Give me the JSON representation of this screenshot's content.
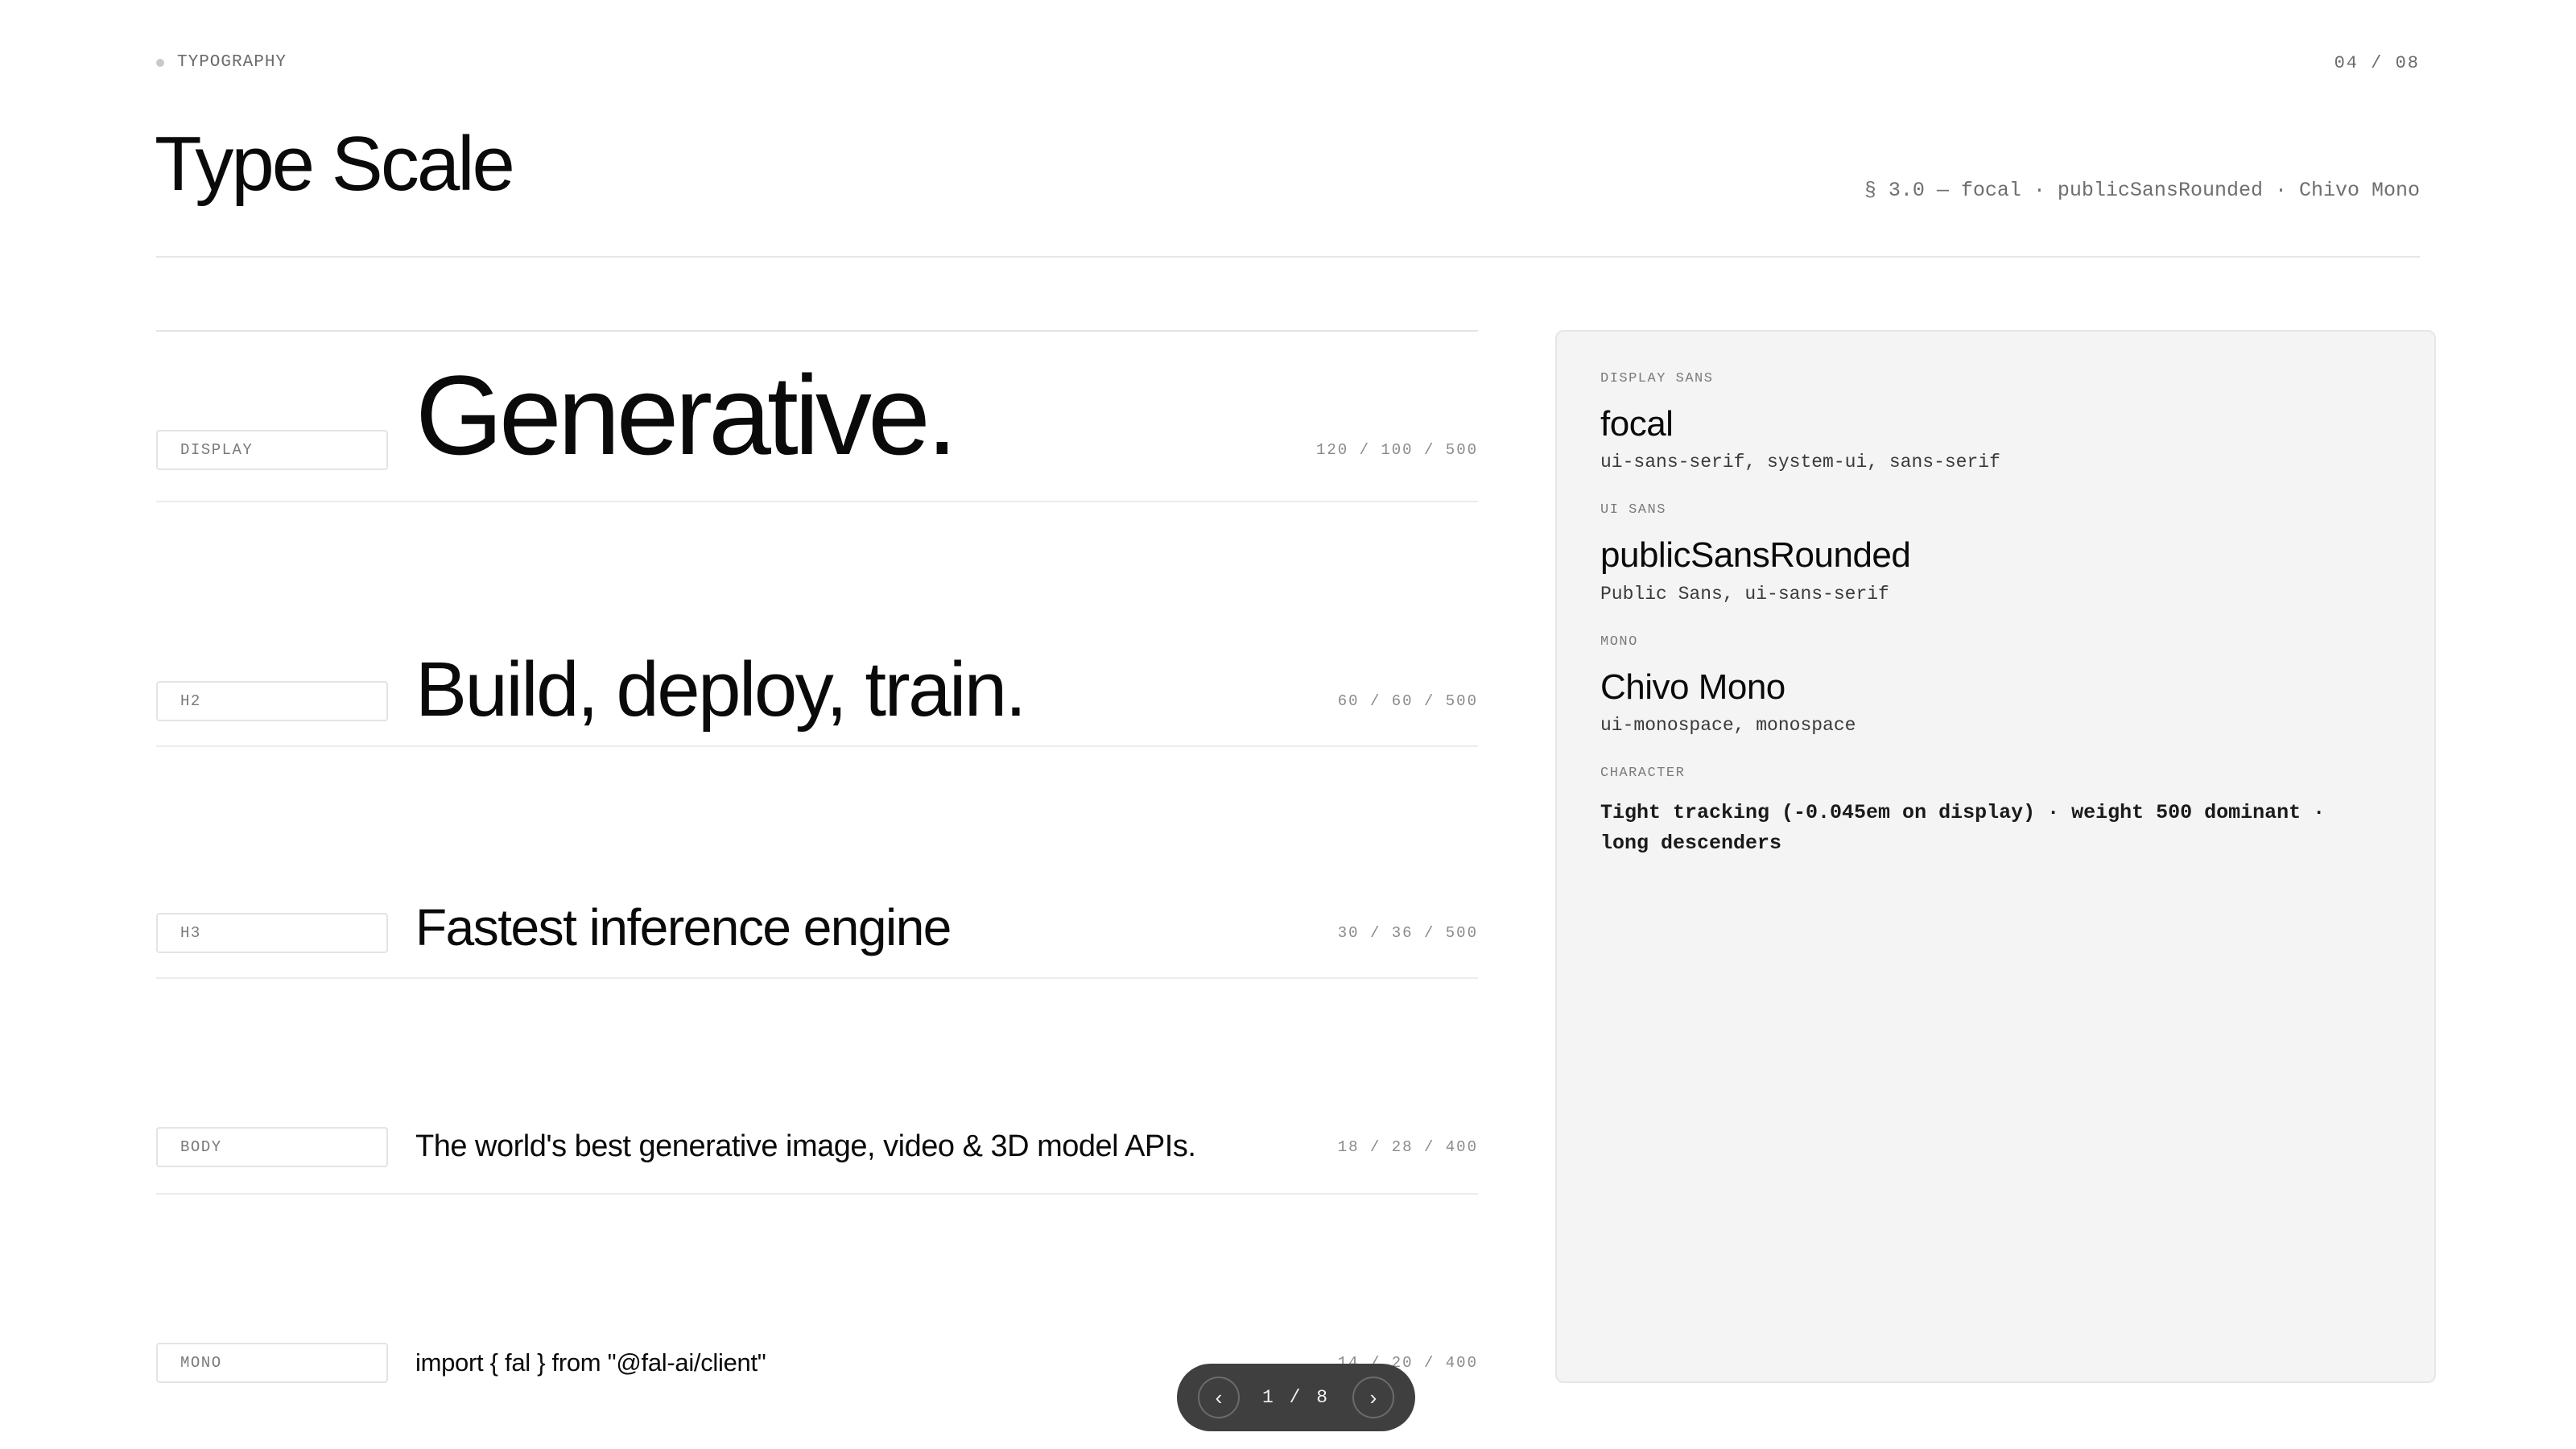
{
  "header": {
    "eyebrow": "TYPOGRAPHY",
    "page_counter": "04 / 08",
    "title": "Type Scale",
    "font_summary": "§ 3.0 — focal · publicSansRounded · Chivo Mono"
  },
  "scale": [
    {
      "tag": "DISPLAY",
      "sample": "Generative.",
      "metrics": "120 / 100 / 500"
    },
    {
      "tag": "H2",
      "sample": "Build, deploy, train.",
      "metrics": "60 / 60 / 500"
    },
    {
      "tag": "H3",
      "sample": "Fastest inference engine",
      "metrics": "30 / 36 / 500"
    },
    {
      "tag": "BODY",
      "sample": "The world's best generative image, video & 3D model APIs.",
      "metrics": "18 / 28 / 400"
    },
    {
      "tag": "MONO",
      "sample": "import { fal } from \"@fal-ai/client\"",
      "metrics": "14 / 20 / 400"
    }
  ],
  "panel": {
    "groups": [
      {
        "label": "DISPLAY SANS",
        "name": "focal",
        "stack": "ui-sans-serif, system-ui, sans-serif"
      },
      {
        "label": "UI SANS",
        "name": "publicSansRounded",
        "stack": "Public Sans, ui-sans-serif"
      },
      {
        "label": "MONO",
        "name": "Chivo Mono",
        "stack": "ui-monospace, monospace"
      }
    ],
    "character": {
      "label": "CHARACTER",
      "text": "Tight tracking (-0.045em on display) · weight 500 dominant · long descenders"
    }
  },
  "pager": {
    "prev_icon": "chevron-left-icon",
    "next_icon": "chevron-right-icon",
    "prev_glyph": "‹",
    "next_glyph": "›",
    "count": "1 / 8"
  }
}
